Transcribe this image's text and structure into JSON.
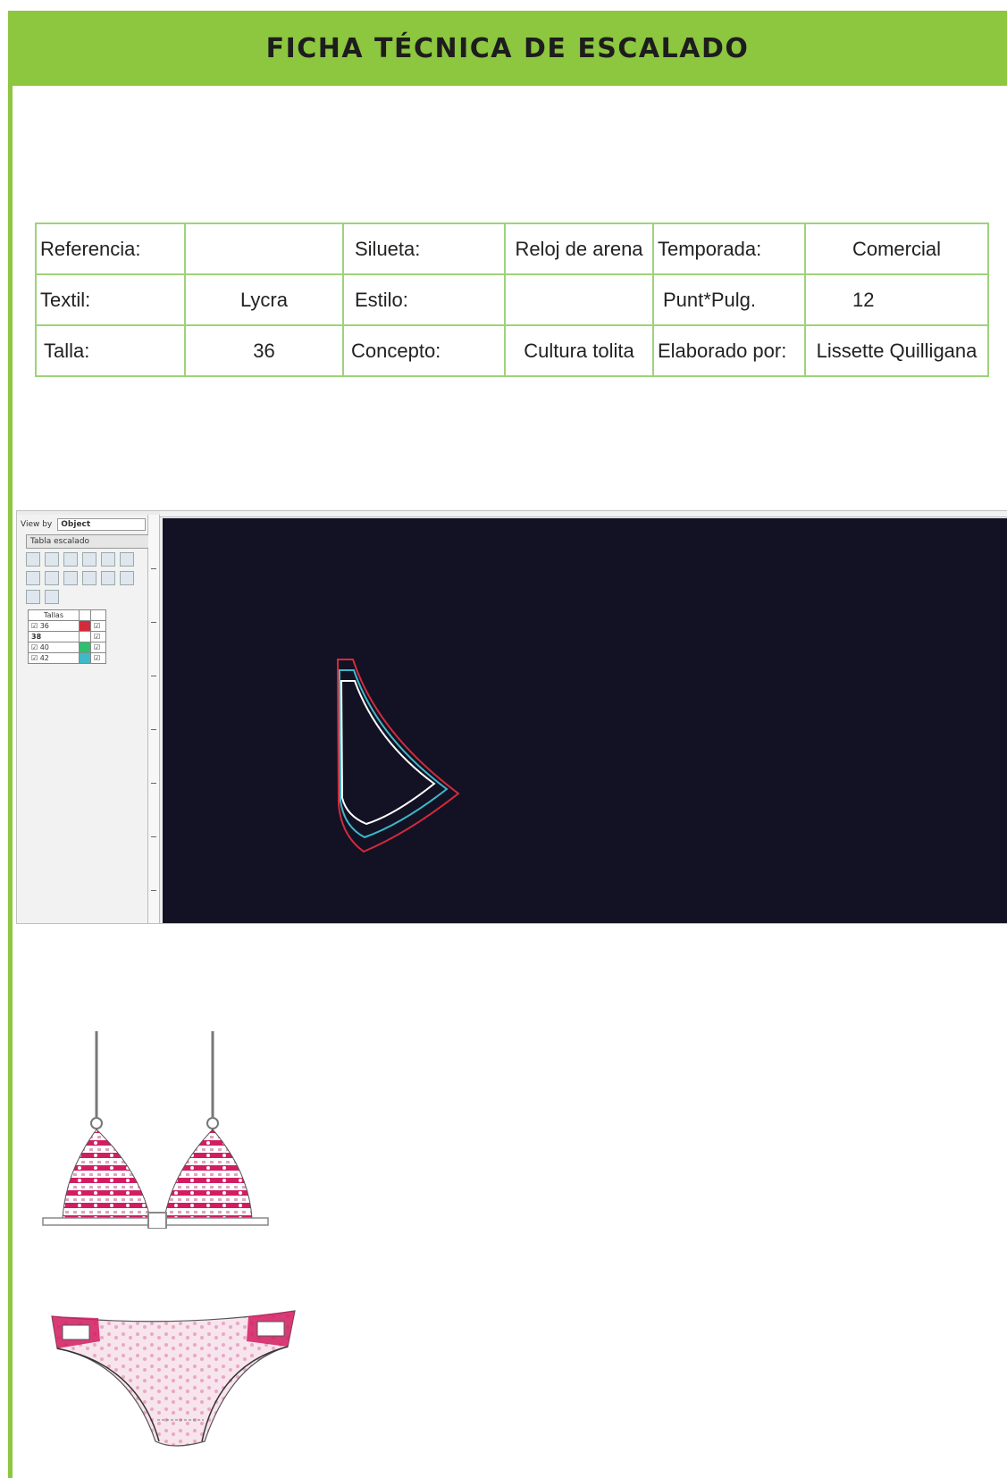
{
  "header": {
    "title": "FICHA TÉCNICA DE ESCALADO"
  },
  "info_table": {
    "rows": [
      [
        "Referencia:",
        "",
        "Silueta:",
        "Reloj de arena",
        "Temporada:",
        "Comercial"
      ],
      [
        "Textil:",
        "Lycra",
        "Estilo:",
        "",
        "Punt*Pulg.",
        "12"
      ],
      [
        "Talla:",
        "36",
        "Concepto:",
        "Cultura tolita",
        "Elaborado por:",
        "Lissette Quilligana"
      ]
    ]
  },
  "cad_screenshot": {
    "view_by_label": "View by",
    "view_by_value": "Object",
    "panel_title": "Tabla escalado",
    "size_table_header": "Tallas",
    "sizes": [
      "36",
      "38",
      "40",
      "42"
    ],
    "size_colors": [
      "#d42a3c",
      "#ffffff",
      "#2fbf71",
      "#3fb8c8"
    ],
    "canvas_color": "#121224"
  },
  "illustrations": {
    "top_icon": "bikini-top-icon",
    "bottom_icon": "bikini-bottom-icon",
    "pattern_color": "#d21d62"
  }
}
